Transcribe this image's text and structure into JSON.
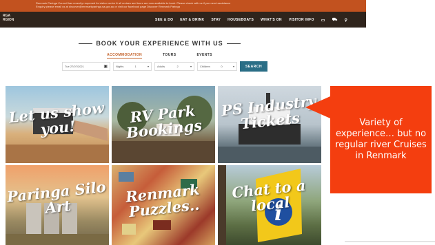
{
  "notice": {
    "line1": "Renmark Paringa Council has recently reopened its visitor centre & all cruises and tours are now available to book. Please check with us if you need assistance",
    "line2": "Enquiry please email us at discover@renmarkparinga.sa.gov.au or visit our facebook page Discover Renmark Paringa"
  },
  "logo": {
    "line1": "RGA",
    "line2": "RGION"
  },
  "nav": {
    "items": [
      "SEE & DO",
      "EAT & DRINK",
      "STAY",
      "HOUSEBOATS",
      "WHAT'S ON",
      "VISITOR INFO"
    ],
    "icons": [
      "calendar-icon",
      "cart-icon",
      "search-icon"
    ]
  },
  "booking": {
    "title": "BOOK YOUR EXPERIENCE WITH US",
    "tabs": [
      "ACCOMMODATION",
      "TOURS",
      "EVENTS"
    ],
    "active_tab": "ACCOMMODATION",
    "date_value": "Tue 27/07/2021",
    "nights_label": "Nights",
    "nights_value": "1",
    "adults_label": "Adults",
    "adults_value": "2",
    "children_label": "Children",
    "children_value": "0",
    "search_label": "SEARCH"
  },
  "tiles": [
    {
      "caption": "Let us show you!"
    },
    {
      "caption": "RV Park Bookings"
    },
    {
      "caption": "PS Industry Tickets"
    },
    {
      "caption": "Paringa Silo Art"
    },
    {
      "caption": "Renmark Puzzles.."
    },
    {
      "caption": "Chat to a local"
    }
  ],
  "callout": {
    "text": "Variety of experience… but no regular river Cruises in Renmark",
    "color": "#f43e0f"
  },
  "colors": {
    "accent": "#c4622a",
    "search_button": "#2a6e86",
    "header": "#2f241c",
    "notice": "#c2521f"
  }
}
